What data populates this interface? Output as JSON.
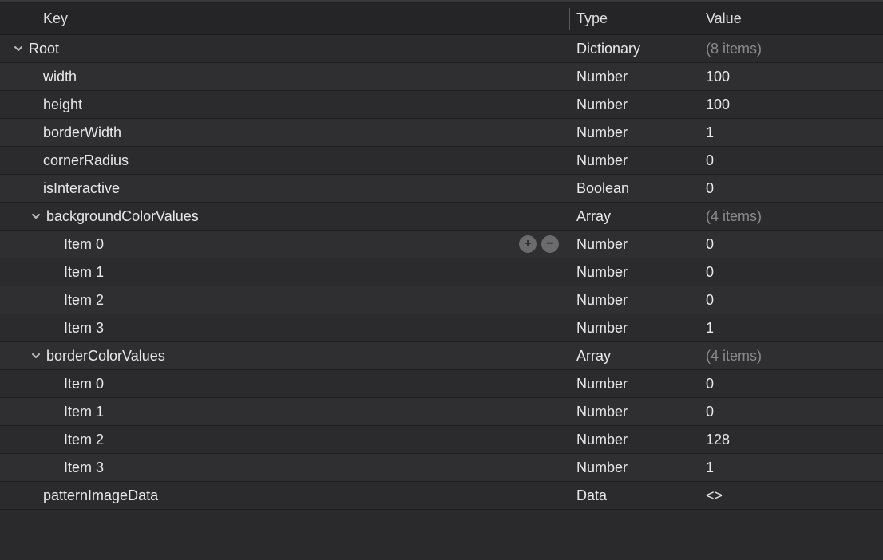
{
  "header": {
    "key": "Key",
    "type": "Type",
    "value": "Value"
  },
  "rows": [
    {
      "indent": 0,
      "chevron": true,
      "key": "Root",
      "type": "Dictionary",
      "value": "(8 items)",
      "muted": true,
      "controls": false
    },
    {
      "indent": 1,
      "chevron": false,
      "key": "width",
      "type": "Number",
      "value": "100",
      "muted": false,
      "controls": false
    },
    {
      "indent": 1,
      "chevron": false,
      "key": "height",
      "type": "Number",
      "value": "100",
      "muted": false,
      "controls": false
    },
    {
      "indent": 1,
      "chevron": false,
      "key": "borderWidth",
      "type": "Number",
      "value": "1",
      "muted": false,
      "controls": false
    },
    {
      "indent": 1,
      "chevron": false,
      "key": "cornerRadius",
      "type": "Number",
      "value": "0",
      "muted": false,
      "controls": false
    },
    {
      "indent": 1,
      "chevron": false,
      "key": "isInteractive",
      "type": "Boolean",
      "value": "0",
      "muted": false,
      "controls": false
    },
    {
      "indent": 1,
      "chevron": true,
      "key": "backgroundColorValues",
      "type": "Array",
      "value": "(4 items)",
      "muted": true,
      "controls": false
    },
    {
      "indent": 2,
      "chevron": false,
      "key": "Item 0",
      "type": "Number",
      "value": "0",
      "muted": false,
      "controls": true
    },
    {
      "indent": 2,
      "chevron": false,
      "key": "Item 1",
      "type": "Number",
      "value": "0",
      "muted": false,
      "controls": false
    },
    {
      "indent": 2,
      "chevron": false,
      "key": "Item 2",
      "type": "Number",
      "value": "0",
      "muted": false,
      "controls": false
    },
    {
      "indent": 2,
      "chevron": false,
      "key": "Item 3",
      "type": "Number",
      "value": "1",
      "muted": false,
      "controls": false
    },
    {
      "indent": 1,
      "chevron": true,
      "key": "borderColorValues",
      "type": "Array",
      "value": "(4 items)",
      "muted": true,
      "controls": false
    },
    {
      "indent": 2,
      "chevron": false,
      "key": "Item 0",
      "type": "Number",
      "value": "0",
      "muted": false,
      "controls": false
    },
    {
      "indent": 2,
      "chevron": false,
      "key": "Item 1",
      "type": "Number",
      "value": "0",
      "muted": false,
      "controls": false
    },
    {
      "indent": 2,
      "chevron": false,
      "key": "Item 2",
      "type": "Number",
      "value": "128",
      "muted": false,
      "controls": false
    },
    {
      "indent": 2,
      "chevron": false,
      "key": "Item 3",
      "type": "Number",
      "value": "1",
      "muted": false,
      "controls": false
    },
    {
      "indent": 1,
      "chevron": false,
      "key": "patternImageData",
      "type": "Data",
      "value": "<>",
      "muted": false,
      "controls": false
    }
  ]
}
